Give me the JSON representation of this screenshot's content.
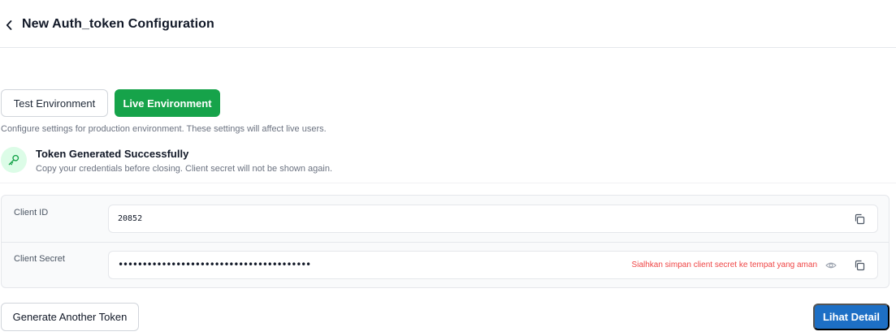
{
  "header": {
    "title": "New Auth_token Configuration",
    "back_icon": "chevron-left-icon"
  },
  "environment": {
    "test_label": "Test Environment",
    "live_label": "Live Environment",
    "selected": "live",
    "description": "Configure settings for production environment. These settings will affect live users."
  },
  "success": {
    "icon": "key-icon",
    "title": "Token Generated Successfully",
    "subtitle": "Copy your credentials before closing. Client secret will not be shown again."
  },
  "credentials": {
    "client_id_label": "Client ID",
    "client_id_value": "20852",
    "client_secret_label": "Client Secret",
    "client_secret_value": "••••••••••••••••••••••••••••••••••••••••",
    "secret_warning": "Sialhkan simpan client secret ke tempat yang aman"
  },
  "actions": {
    "generate_label": "Generate Another Token",
    "detail_label": "Lihat Detail"
  },
  "colors": {
    "live_green": "#16a34a",
    "primary_blue": "#1d6fc5",
    "warning_red": "#ef4444",
    "success_bg": "#dcfce7"
  }
}
